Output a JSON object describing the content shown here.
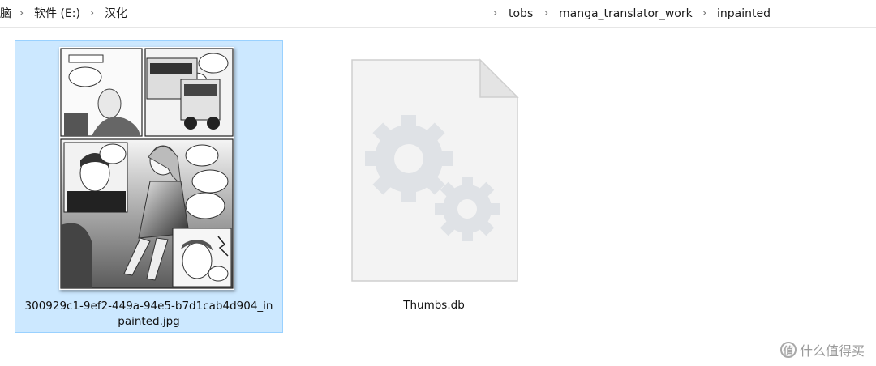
{
  "breadcrumb": {
    "items": [
      "脑",
      "软件 (E:)",
      "汉化",
      "tobs",
      "manga_translator_work",
      "inpainted"
    ],
    "separator": "›"
  },
  "files": [
    {
      "name_line1": "300929c1-9ef2-449a-94e5-b7d1cab4d904_in",
      "name_line2": "painted.jpg",
      "selected": true,
      "icon": "manga-image-thumbnail"
    },
    {
      "name_line1": "Thumbs.db",
      "selected": false,
      "icon": "system-file-gears-icon"
    }
  ],
  "watermark": {
    "badge": "值",
    "text": "什么值得买"
  },
  "colors": {
    "selection_bg": "#cce8ff",
    "selection_border": "#99d1ff"
  }
}
